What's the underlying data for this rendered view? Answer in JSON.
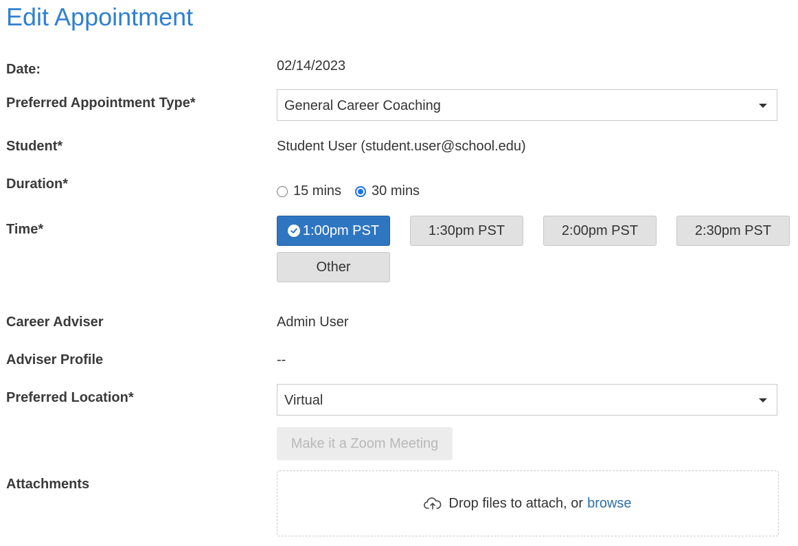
{
  "page": {
    "title": "Edit Appointment"
  },
  "date": {
    "label": "Date:",
    "value": "02/14/2023"
  },
  "appointment_type": {
    "label": "Preferred Appointment Type*",
    "selected": "General Career Coaching"
  },
  "student": {
    "label": "Student*",
    "value": "Student User (student.user@school.edu)"
  },
  "duration": {
    "label": "Duration*",
    "options": [
      {
        "label": "15 mins",
        "checked": false
      },
      {
        "label": "30 mins",
        "checked": true
      }
    ]
  },
  "time": {
    "label": "Time*",
    "slots": [
      {
        "label": "1:00pm PST",
        "selected": true
      },
      {
        "label": "1:30pm PST",
        "selected": false
      },
      {
        "label": "2:00pm PST",
        "selected": false
      },
      {
        "label": "2:30pm PST",
        "selected": false
      },
      {
        "label": "Other",
        "selected": false
      }
    ]
  },
  "adviser": {
    "label": "Career Adviser",
    "value": "Admin User"
  },
  "adviser_profile": {
    "label": "Adviser Profile",
    "value": "--"
  },
  "location": {
    "label": "Preferred Location*",
    "selected": "Virtual"
  },
  "zoom": {
    "label": "Make it a Zoom Meeting",
    "disabled": true
  },
  "attachments": {
    "label": "Attachments",
    "drop_text": "Drop files to attach, or",
    "browse_label": "browse"
  },
  "colors": {
    "title": "#2f80d1",
    "selected_slot": "#2f76c1",
    "link": "#2e6ea6",
    "radio_checked": "#1a73e8"
  },
  "icons": {
    "selected_slot": "check-circle-icon",
    "select_caret": "caret-down-icon",
    "upload": "cloud-upload-icon"
  }
}
